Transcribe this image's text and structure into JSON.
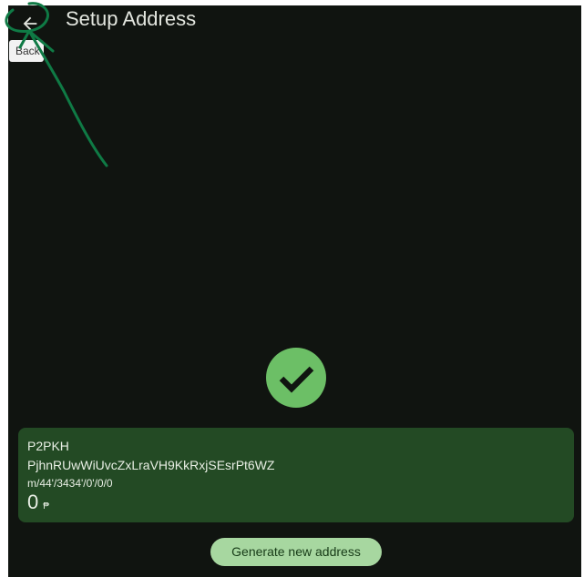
{
  "header": {
    "title": "Setup Address",
    "back_tooltip": "Back"
  },
  "status": {
    "icon": "check-circle-icon",
    "color": "#6cbf66"
  },
  "address_card": {
    "type": "P2PKH",
    "address": "PjhnRUwWiUvcZxLraVH9KkRxjSEsrPt6WZ",
    "derivation_path": "m/44'/3434'/0'/0/0",
    "balance": "0",
    "currency_symbol": "₱"
  },
  "actions": {
    "generate_label": "Generate new address"
  },
  "colors": {
    "background": "#101410",
    "card": "#234a24",
    "button": "#a7d7a0",
    "annotation": "#0f7a45"
  }
}
